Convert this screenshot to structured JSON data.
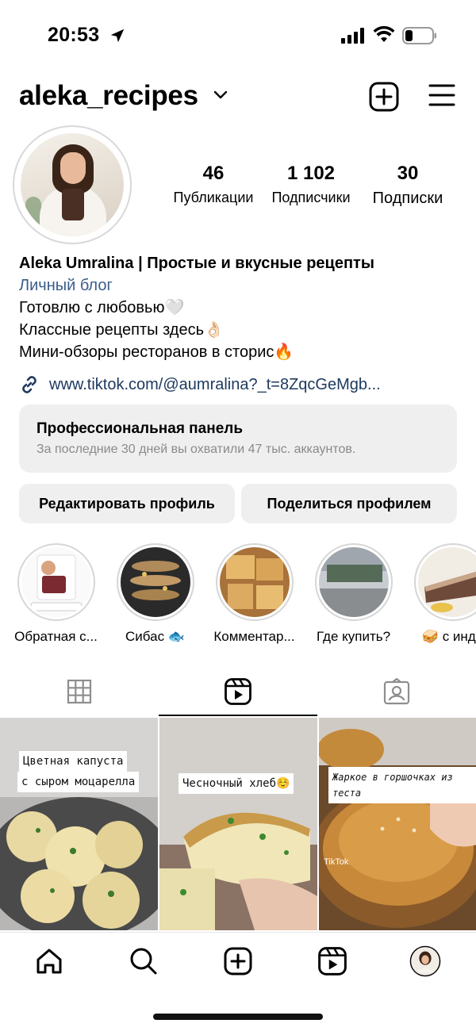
{
  "status_bar": {
    "time": "20:53"
  },
  "header": {
    "username": "aleka_recipes"
  },
  "stats": {
    "posts": {
      "value": "46",
      "label": "Публикации"
    },
    "followers": {
      "value": "1 102",
      "label": "Подписчики"
    },
    "following": {
      "value": "30",
      "label": "Подписки"
    }
  },
  "bio": {
    "name": "Aleka Umralina | Простые и вкусные рецепты",
    "category": "Личный блог",
    "lines": [
      "Готовлю с любовью🤍",
      "Классные рецепты здесь👌🏻",
      "Мини-обзоры ресторанов в сторис🔥"
    ],
    "link": "www.tiktok.com/@aumralina?_t=8ZqcGeMgb..."
  },
  "pro_panel": {
    "title": "Профессиональная панель",
    "subtitle": "За последние 30 дней вы охватили 47 тыс. аккаунтов."
  },
  "buttons": {
    "edit": "Редактировать профиль",
    "share": "Поделиться профилем"
  },
  "highlights": [
    {
      "label": "Обратная с..."
    },
    {
      "label": "Сибас 🐟"
    },
    {
      "label": "Комментар..."
    },
    {
      "label": "Где купить?"
    },
    {
      "label": "🥪 с инде"
    }
  ],
  "tabs": [
    "grid",
    "reels",
    "tagged"
  ],
  "posts": [
    {
      "caption_lines": [
        "Цветная капуста",
        "с сыром моцарелла"
      ]
    },
    {
      "caption_lines": [
        "Чесночный хлеб☺️"
      ]
    },
    {
      "caption_lines": [
        "Жаркое в горшочках из теста"
      ],
      "watermark": "TikTok"
    }
  ],
  "colors": {
    "link": "#1e3a60",
    "category": "#3a5d8a",
    "panel_bg": "#efefef",
    "muted_text": "#8a8a8a"
  },
  "bottom_nav": [
    "home-icon",
    "search-icon",
    "create-icon",
    "reels-icon",
    "profile-avatar"
  ]
}
